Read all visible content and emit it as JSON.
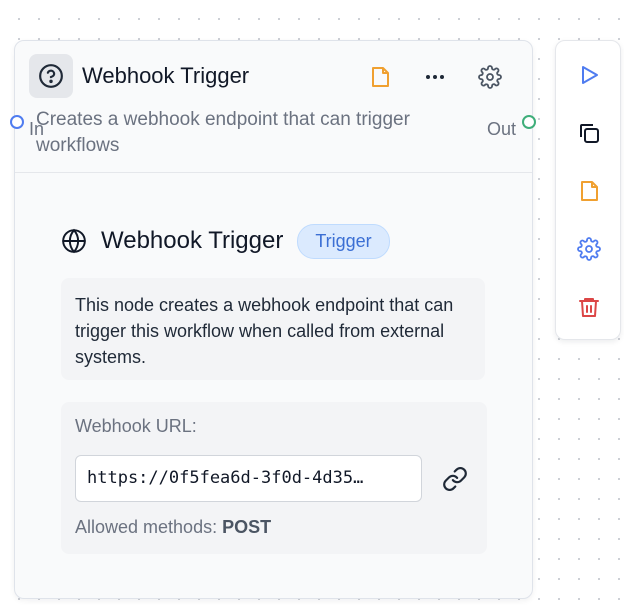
{
  "node": {
    "title": "Webhook Trigger",
    "description": "Creates a webhook endpoint that can trigger workflows",
    "input_label": "In",
    "output_label": "Out",
    "icons": [
      "help-icon",
      "note-icon",
      "more-icon",
      "gear-icon"
    ]
  },
  "body": {
    "title": "Webhook Trigger",
    "badge": "Trigger",
    "info": "This node creates a webhook endpoint that can trigger this workflow when called from external systems.",
    "url_label": "Webhook URL:",
    "url_value": "https://0f5fea6d-3f0d-4d35…",
    "methods_label": "Allowed methods:",
    "methods_value": "POST"
  },
  "toolbar": {
    "items": [
      "play-icon",
      "copy-icon",
      "note-icon",
      "gear-icon",
      "trash-icon"
    ]
  },
  "colors": {
    "accent_blue": "#4f7cf0",
    "note_orange": "#f0a030",
    "danger_red": "#dc4646",
    "port_in": "#4f7cf0",
    "port_out": "#3fae7a",
    "badge_bg": "#dbeafe",
    "badge_text": "#3b6fd4"
  }
}
